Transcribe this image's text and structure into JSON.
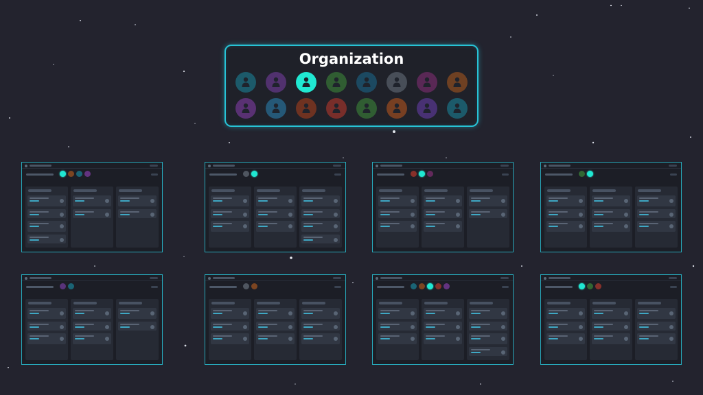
{
  "organization": {
    "title": "Organization",
    "members": [
      {
        "icon": "person-icon",
        "color": "#1a8aa0",
        "highlighted": false
      },
      {
        "icon": "person-icon",
        "color": "#7b3fa8",
        "highlighted": false
      },
      {
        "icon": "person-icon",
        "color": "#20e8d2",
        "highlighted": true
      },
      {
        "icon": "person-icon",
        "color": "#3f8f3a",
        "highlighted": false
      },
      {
        "icon": "person-icon",
        "color": "#1b6a8f",
        "highlighted": false
      },
      {
        "icon": "person-icon",
        "color": "#6b7480",
        "highlighted": false
      },
      {
        "icon": "person-icon",
        "color": "#8a2f7a",
        "highlighted": false
      },
      {
        "icon": "person-icon",
        "color": "#b05a1e",
        "highlighted": false
      },
      {
        "icon": "person-icon",
        "color": "#8a3fb0",
        "highlighted": false
      },
      {
        "icon": "person-icon",
        "color": "#2a85b8",
        "highlighted": false
      },
      {
        "icon": "person-icon",
        "color": "#b0401c",
        "highlighted": false
      },
      {
        "icon": "person-icon",
        "color": "#c23a2c",
        "highlighted": false
      },
      {
        "icon": "person-icon",
        "color": "#3e8f3a",
        "highlighted": false
      },
      {
        "icon": "person-icon",
        "color": "#c0581e",
        "highlighted": false
      },
      {
        "icon": "person-icon",
        "color": "#6a3fb0",
        "highlighted": false
      },
      {
        "icon": "person-icon",
        "color": "#1a8aa0",
        "highlighted": false
      }
    ]
  },
  "boards": [
    {
      "members": [
        "#20e8d2",
        "#b05a1e",
        "#1a8aa0",
        "#8a3fb0"
      ],
      "highlight": 0,
      "columns": [
        4,
        2,
        2
      ]
    },
    {
      "members": [
        "#6b7480",
        "#20e8d2"
      ],
      "highlight": 1,
      "columns": [
        3,
        3,
        4
      ]
    },
    {
      "members": [
        "#c23a2c",
        "#20e8d2",
        "#8a2f7a"
      ],
      "highlight": 1,
      "columns": [
        3,
        3,
        2
      ]
    },
    {
      "members": [
        "#3f8f3a",
        "#20e8d2"
      ],
      "highlight": 1,
      "columns": [
        3,
        3,
        3
      ]
    },
    {
      "members": [
        "#7b3fa8",
        "#1a8aa0"
      ],
      "highlight": -1,
      "columns": [
        3,
        3,
        2
      ]
    },
    {
      "members": [
        "#6b7480",
        "#b05a1e"
      ],
      "highlight": -1,
      "columns": [
        3,
        3,
        3
      ]
    },
    {
      "members": [
        "#1a8aa0",
        "#b05a1e",
        "#20e8d2",
        "#c23a2c",
        "#8a3fb0"
      ],
      "highlight": 2,
      "columns": [
        3,
        3,
        4
      ]
    },
    {
      "members": [
        "#20e8d2",
        "#3f8f3a",
        "#c23a2c"
      ],
      "highlight": 0,
      "columns": [
        3,
        3,
        3
      ]
    }
  ]
}
